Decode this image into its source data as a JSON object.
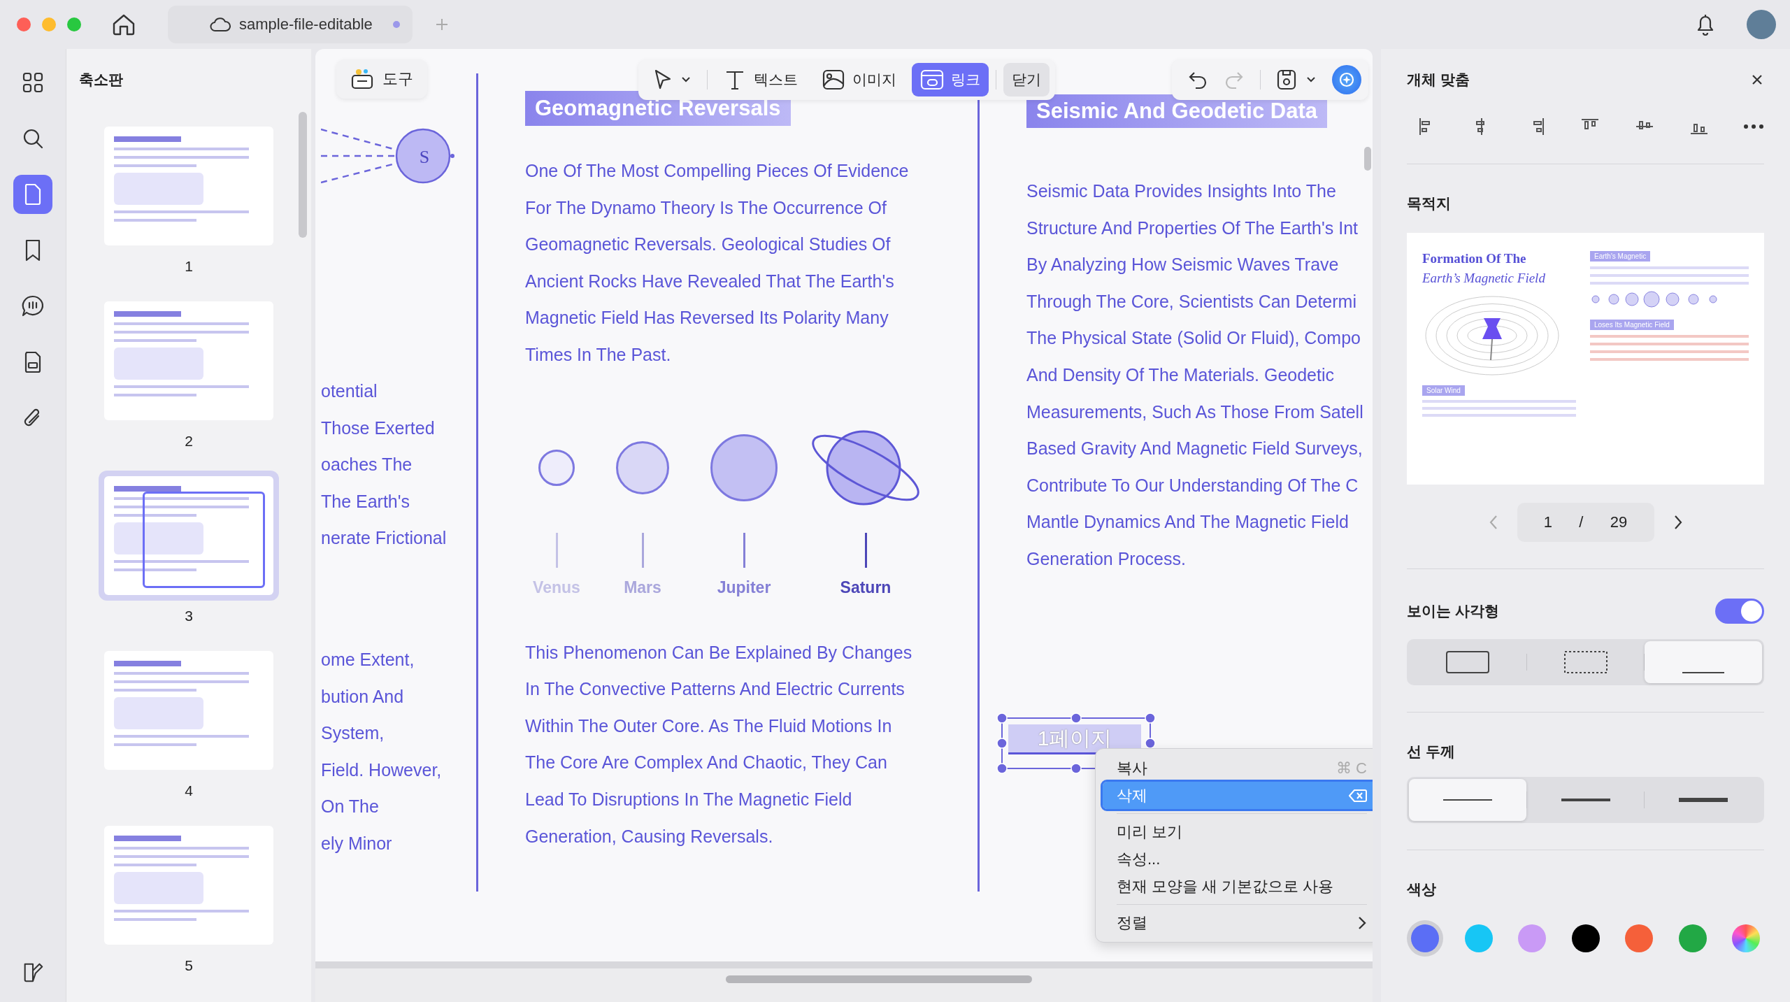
{
  "window": {
    "tab_title": "sample-file-editable",
    "tab_modified": true
  },
  "rail": [
    {
      "kind": "apps",
      "selected": false
    },
    {
      "kind": "search",
      "selected": false
    },
    {
      "kind": "pages",
      "selected": true
    },
    {
      "kind": "bookmark",
      "selected": false
    },
    {
      "kind": "comment",
      "selected": false
    },
    {
      "kind": "form",
      "selected": false
    },
    {
      "kind": "attachment",
      "selected": false
    }
  ],
  "thumbnails": {
    "title": "축소판",
    "pages": [
      {
        "label": "1",
        "selected": false
      },
      {
        "label": "2",
        "selected": false
      },
      {
        "label": "3",
        "selected": true
      },
      {
        "label": "4",
        "selected": false
      },
      {
        "label": "5",
        "selected": false
      }
    ]
  },
  "toolbar": {
    "tools_label": "도구",
    "items": [
      {
        "kind": "select",
        "selected": false
      },
      {
        "kind": "text",
        "label": "텍스트",
        "selected": false
      },
      {
        "kind": "image",
        "label": "이미지",
        "selected": false
      },
      {
        "kind": "link",
        "label": "링크",
        "selected": true
      }
    ],
    "close_label": "닫기",
    "redo_disabled": true
  },
  "document": {
    "left_column": {
      "diagram_label": "S",
      "paragraphs": [
        [
          "otential",
          "Those Exerted",
          "oaches The",
          "The Earth's",
          "nerate Frictional"
        ],
        [
          "ome Extent,",
          "bution And",
          "System,",
          "Field. However,",
          "On The",
          "ely Minor"
        ]
      ]
    },
    "middle_column": {
      "heading": "Geomagnetic Reversals",
      "paragraph_1": [
        "One Of The Most Compelling Pieces Of Evidence",
        "For The Dynamo Theory Is The Occurrence Of",
        "Geomagnetic Reversals. Geological Studies Of",
        "Ancient Rocks Have Revealed That The Earth's",
        "Magnetic Field Has Reversed Its Polarity Many",
        "Times In The Past."
      ],
      "planets": [
        {
          "name": "Venus"
        },
        {
          "name": "Mars"
        },
        {
          "name": "Jupiter"
        },
        {
          "name": "Saturn"
        }
      ],
      "paragraph_2": [
        "This Phenomenon Can Be Explained By Changes",
        "In The Convective Patterns And Electric Currents",
        "Within The Outer Core. As The Fluid Motions In",
        "The Core Are Complex And Chaotic, They Can",
        "Lead To Disruptions In The Magnetic Field",
        "Generation, Causing Reversals."
      ]
    },
    "right_column": {
      "heading": "Seismic And Geodetic Data",
      "paragraph": [
        "Seismic Data Provides Insights Into The",
        "Structure And Properties Of The Earth's Int",
        "By Analyzing How Seismic Waves Trave",
        "Through The Core, Scientists Can Determi",
        "The Physical State (Solid Or Fluid), Compo",
        "And Density Of The Materials. Geodetic",
        "Measurements, Such As Those From Satell",
        "Based Gravity And Magnetic Field Surveys,",
        "Contribute To Our Understanding Of The C",
        "Mantle Dynamics And The Magnetic Field",
        "Generation Process."
      ]
    }
  },
  "link_box": {
    "text": "1페이지"
  },
  "context_menu": {
    "groups": [
      [
        {
          "label": "복사",
          "kind": "shortcut",
          "shortcut": "⌘ C",
          "selected": false
        },
        {
          "label": "삭제",
          "kind": "delete",
          "selected": true
        }
      ],
      [
        {
          "label": "미리 보기",
          "kind": "plain",
          "selected": false
        },
        {
          "label": "속성...",
          "kind": "plain",
          "selected": false
        },
        {
          "label": "현재 모양을 새 기본값으로 사용",
          "kind": "plain",
          "selected": false
        }
      ],
      [
        {
          "label": "정렬",
          "kind": "submenu",
          "selected": false
        }
      ]
    ]
  },
  "panel": {
    "title": "개체 맞춤",
    "destination_label": "목적지",
    "preview": {
      "title_line_1": "Formation Of The",
      "title_line_2": "Earth’s Magnetic Field",
      "labels": [
        "Earth's Magnetic",
        "Loses Its Magnetic Field",
        "Solar Wind"
      ]
    },
    "page": {
      "current": "1",
      "separator": "/",
      "total": "29"
    },
    "visible_rect": {
      "label": "보이는 사각형",
      "on": true,
      "styles": [
        {
          "kind": "solid",
          "selected": false
        },
        {
          "kind": "dashed",
          "selected": false
        },
        {
          "kind": "underline",
          "selected": true
        }
      ]
    },
    "line_width": {
      "label": "선 두께",
      "options": [
        {
          "kind": "thin",
          "selected": true
        },
        {
          "kind": "medium",
          "selected": false
        },
        {
          "kind": "thick",
          "selected": false
        }
      ]
    },
    "color": {
      "label": "색상",
      "swatches": [
        {
          "kind": "solid",
          "color": "#5b6ef5",
          "selected": true
        },
        {
          "kind": "solid",
          "color": "#17c6f5",
          "selected": false
        },
        {
          "kind": "solid",
          "color": "#c99af6",
          "selected": false
        },
        {
          "kind": "solid",
          "color": "#000000",
          "selected": false
        },
        {
          "kind": "solid",
          "color": "#f5603a",
          "selected": false
        },
        {
          "kind": "solid",
          "color": "#22a845",
          "selected": false
        },
        {
          "kind": "spectrum",
          "selected": false
        }
      ]
    }
  }
}
